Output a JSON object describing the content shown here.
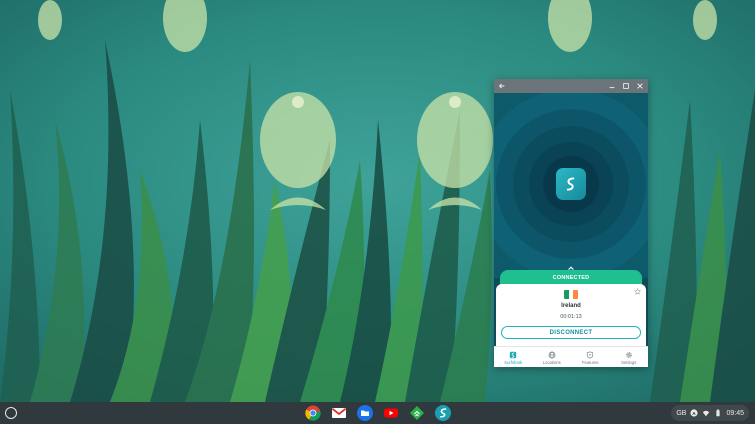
{
  "window": {
    "connection_status": "CONNECTED",
    "location": "Ireland",
    "timer": "00:01:13",
    "disconnect_label": "DISCONNECT",
    "flag_colors": [
      "#169b62",
      "#ffffff",
      "#ff883e"
    ]
  },
  "bottom_nav": [
    {
      "label": "Surfshark",
      "icon": "surfshark-icon",
      "active": true
    },
    {
      "label": "Locations",
      "icon": "globe-icon",
      "active": false
    },
    {
      "label": "Features",
      "icon": "shield-icon",
      "active": false
    },
    {
      "label": "Settings",
      "icon": "gear-icon",
      "active": false
    }
  ],
  "shelf": {
    "apps": [
      "chrome-icon",
      "gmail-icon",
      "files-icon",
      "youtube-icon",
      "feedly-icon",
      "surfshark-icon"
    ],
    "tray": {
      "keyboard_layout": "GB",
      "time": "09:45"
    }
  },
  "colors": {
    "accent_green": "#1fbf8f",
    "accent_teal": "#1fb5c0",
    "window_bg": "#0f4a59"
  }
}
